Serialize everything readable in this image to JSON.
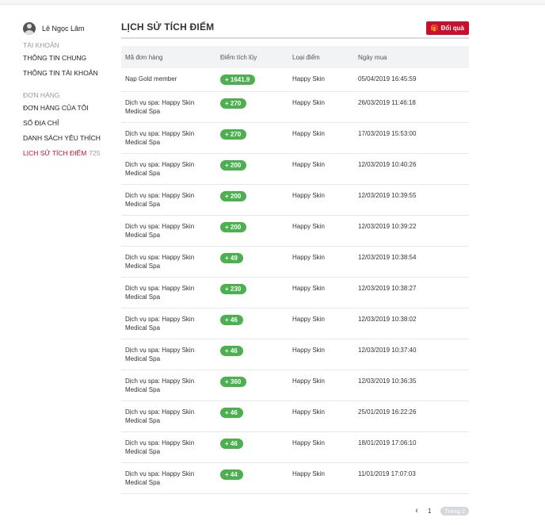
{
  "user": {
    "name": "Lê Ngọc Lâm"
  },
  "sidebar": {
    "account_title": "TÀI KHOẢN",
    "account_items": [
      {
        "label": "THÔNG TIN CHUNG"
      },
      {
        "label": "THÔNG TIN TÀI KHOẢN"
      }
    ],
    "orders_title": "ĐƠN HÀNG",
    "orders_items": [
      {
        "label": "ĐƠN HÀNG CỦA TÔI"
      },
      {
        "label": "SỔ ĐỊA CHỈ"
      },
      {
        "label": "DANH SÁCH YÊU THÍCH"
      },
      {
        "label": "LỊCH SỬ TÍCH ĐIỂM",
        "count": "725"
      }
    ]
  },
  "page": {
    "title": "LỊCH SỬ TÍCH ĐIỂM",
    "redeem_label": "Đổi quà"
  },
  "table": {
    "headers": [
      "Mã đơn hàng",
      "Điểm tích lũy",
      "Loại điểm",
      "Ngày mua"
    ],
    "rows": [
      {
        "order": "Nạp Gold member",
        "points": "+ 1641.9",
        "type": "Happy Skin",
        "date": "05/04/2019 16:45:59"
      },
      {
        "order": "Dịch vụ spa: Happy Skin Medical Spa",
        "points": "+ 270",
        "type": "Happy Skin",
        "date": "26/03/2019 11:46:18"
      },
      {
        "order": "Dịch vụ spa: Happy Skin Medical Spa",
        "points": "+ 270",
        "type": "Happy Skin",
        "date": "17/03/2019 15:53:00"
      },
      {
        "order": "Dịch vụ spa: Happy Skin Medical Spa",
        "points": "+ 200",
        "type": "Happy Skin",
        "date": "12/03/2019 10:40:26"
      },
      {
        "order": "Dịch vụ spa: Happy Skin Medical Spa",
        "points": "+ 200",
        "type": "Happy Skin",
        "date": "12/03/2019 10:39:55"
      },
      {
        "order": "Dịch vụ spa: Happy Skin Medical Spa",
        "points": "+ 200",
        "type": "Happy Skin",
        "date": "12/03/2019 10:39:22"
      },
      {
        "order": "Dịch vụ spa: Happy Skin Medical Spa",
        "points": "+ 49",
        "type": "Happy Skin",
        "date": "12/03/2019 10:38:54"
      },
      {
        "order": "Dịch vụ spa: Happy Skin Medical Spa",
        "points": "+ 230",
        "type": "Happy Skin",
        "date": "12/03/2019 10:38:27"
      },
      {
        "order": "Dịch vụ spa: Happy Skin Medical Spa",
        "points": "+ 46",
        "type": "Happy Skin",
        "date": "12/03/2019 10:38:02"
      },
      {
        "order": "Dịch vụ spa: Happy Skin Medical Spa",
        "points": "+ 46",
        "type": "Happy Skin",
        "date": "12/03/2019 10:37:40"
      },
      {
        "order": "Dịch vụ spa: Happy Skin Medical Spa",
        "points": "+ 360",
        "type": "Happy Skin",
        "date": "12/03/2019 10:36:35"
      },
      {
        "order": "Dịch vụ spa: Happy Skin Medical Spa",
        "points": "+ 46",
        "type": "Happy Skin",
        "date": "25/01/2019 16:22:26"
      },
      {
        "order": "Dịch vụ spa: Happy Skin Medical Spa",
        "points": "+ 46",
        "type": "Happy Skin",
        "date": "18/01/2019 17:06:10"
      },
      {
        "order": "Dịch vụ spa: Happy Skin Medical Spa",
        "points": "+ 44",
        "type": "Happy Skin",
        "date": "11/01/2019 17:07:03"
      }
    ]
  },
  "pagination": {
    "prev": "‹",
    "current": "1",
    "next_label": "Trang 2"
  },
  "icons": {
    "avatar": "user-avatar",
    "redeem": "gift-icon",
    "prev": "chevron-left-icon"
  },
  "colors": {
    "accent": "#c8102e",
    "badge": "#4caf50",
    "header_bg": "#f2f3f5"
  }
}
